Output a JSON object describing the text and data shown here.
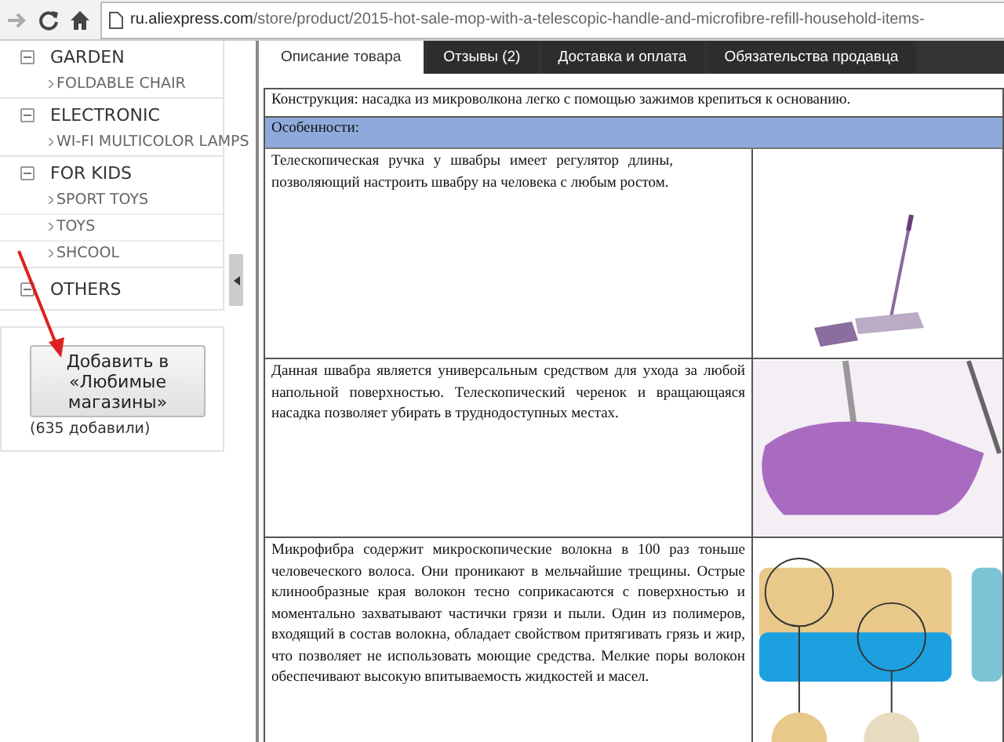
{
  "browser": {
    "url_domain": "ru.aliexpress.com",
    "url_path": "/store/product/2015-hot-sale-mop-with-a-telescopic-handle-and-microfibre-refill-household-items-"
  },
  "sidebar": {
    "categories": [
      {
        "name": "GARDEN",
        "expanded": true,
        "children": [
          {
            "name": "FOLDABLE CHAIR"
          }
        ]
      },
      {
        "name": "ELECTRONIC",
        "expanded": true,
        "children": [
          {
            "name": "WI-FI MULTICOLOR LAMPS"
          }
        ]
      },
      {
        "name": "FOR KIDS",
        "expanded": true,
        "children": [
          {
            "name": "SPORT TOYS"
          },
          {
            "name": "TOYS"
          },
          {
            "name": "SHCOOL"
          }
        ]
      },
      {
        "name": "OTHERS",
        "expanded": true
      }
    ],
    "favorite_button": "Добавить в «Любимые магазины»",
    "favorite_count": "(635 добавили)"
  },
  "tabs": [
    {
      "label": "Описание товара",
      "selected": true
    },
    {
      "label": "Отзывы (2)",
      "selected": false
    },
    {
      "label": "Доставка и оплата",
      "selected": false
    },
    {
      "label": "Обязательства продавца",
      "selected": false
    }
  ],
  "description": {
    "intro": "Конструкция: насадка из микроволкона легко с помощью зажимов крепиться к основанию.",
    "section_header": "Особенности:",
    "rows": [
      {
        "text": "Телескопическая ручка у швабры имеет регулятор длины, позволяющий настроить швабру на человека с любым ростом."
      },
      {
        "text": "Данная швабра является универсальным средством для ухода за любой напольной поверхностью. Телескопический черенок и вращающаяся насадка позволяет убирать в труднодоступных местах."
      },
      {
        "text": "Микрофибра содержит микроскопические волокна в 100 раз тоньше человеческого волоса. Они проникают в мельчайшие трещины. Острые клинообразные края волокон тесно соприкасаются с поверхностью и моментально захватывают частички грязи и пыли. Один из полимеров, входящий в состав волокна, обладает свойством притягивать грязь и жир, что позволяет не использовать моющие средства. Мелкие поры волокон обеспечивают высокую впитываемость жидкостей и масел."
      }
    ]
  }
}
